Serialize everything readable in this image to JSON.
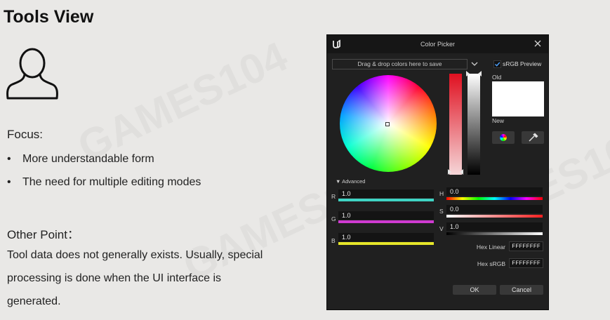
{
  "slide": {
    "title": "Tools View",
    "focus_heading": "Focus:",
    "bullets": [
      "More understandable form",
      "The need for multiple editing modes"
    ],
    "other_heading": "Other Point：",
    "other_text": "Tool data does not generally exists. Usually, special processing is done when the UI interface is generated."
  },
  "dialog": {
    "title": "Color Picker",
    "dropzone": "Drag & drop colors here to save",
    "srgb_preview_label": "sRGB Preview",
    "srgb_preview_checked": true,
    "old_label": "Old",
    "new_label": "New",
    "advanced_label": "Advanced",
    "rgb": [
      {
        "label": "R",
        "value": "1.0",
        "color": "#3fd4c4"
      },
      {
        "label": "G",
        "value": "1.0",
        "color": "#cf3ad1"
      },
      {
        "label": "B",
        "value": "1.0",
        "color": "#e6e62a"
      }
    ],
    "hsv": [
      {
        "label": "H",
        "value": "0.0"
      },
      {
        "label": "S",
        "value": "0.0"
      },
      {
        "label": "V",
        "value": "1.0"
      }
    ],
    "hex_linear_label": "Hex Linear",
    "hex_linear_value": "FFFFFFFF",
    "hex_srgb_label": "Hex sRGB",
    "hex_srgb_value": "FFFFFFFF",
    "ok_label": "OK",
    "cancel_label": "Cancel",
    "old_color": "#ffffff",
    "new_color": "#ffffff"
  }
}
